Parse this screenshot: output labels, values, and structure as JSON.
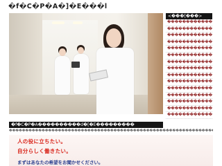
{
  "header": {
    "site_title": "�f�C�P�A�]�E���l"
  },
  "sidebar": {
    "heading": "<���[���>",
    "items": [
      "�������������",
      "�������������",
      "�������������",
      "�������������",
      "�������������",
      "�������������",
      "�������������",
      "�������������",
      "�������������",
      "�������������",
      "�������������",
      "�������������",
      "�������������",
      "�������������",
      "�������������"
    ]
  },
  "content": {
    "breadcrumb": "�f�C�P�A����������d�[�E���������",
    "intro": "������������������������������������������������������������������������������������������������������������",
    "banner": {
      "line1": "人の役に立ちたい。",
      "line2": "自分らしく働きたい。",
      "line3": "まずはあなたの希望をお聞かせください。"
    }
  }
}
